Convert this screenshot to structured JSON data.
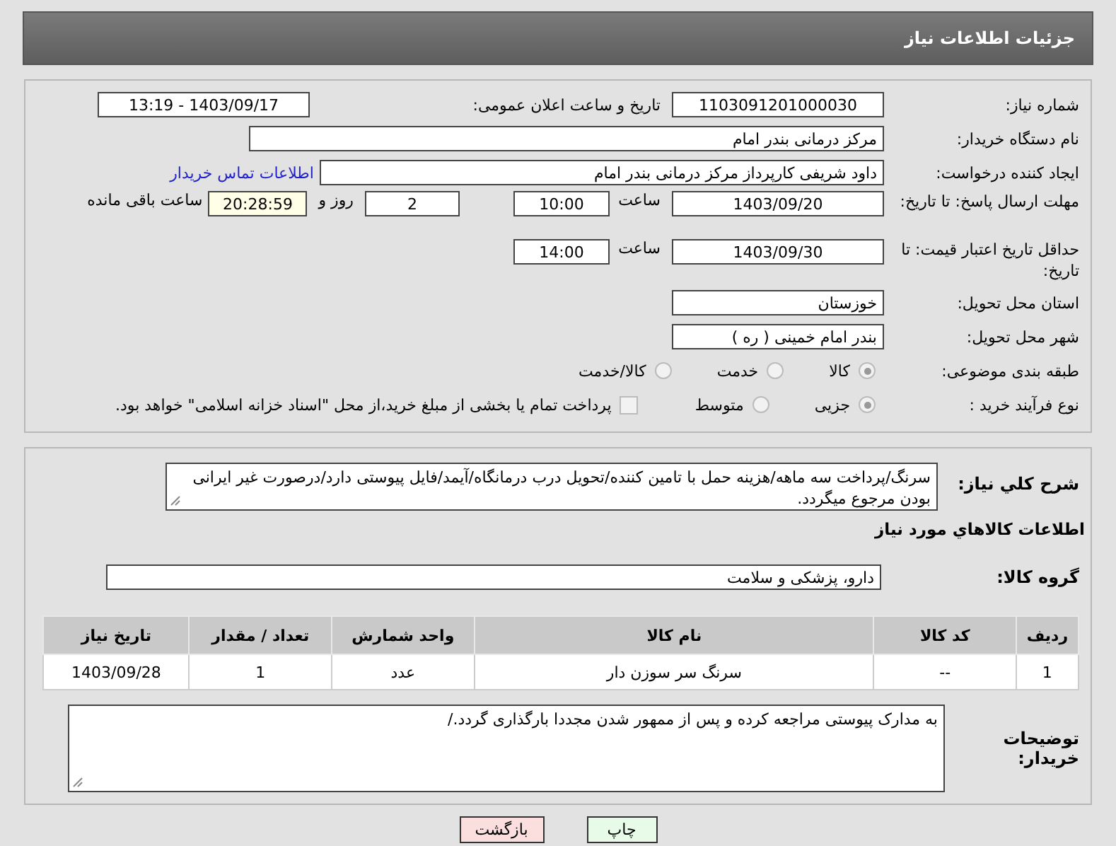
{
  "header": {
    "title": "جزئیات اطلاعات نیاز"
  },
  "details": {
    "need_number": {
      "label": "شماره نیاز:",
      "value": "1103091201000030"
    },
    "announce": {
      "label": "تاریخ و ساعت اعلان عمومی:",
      "value": "1403/09/17 - 13:19"
    },
    "buyer_org": {
      "label": "نام دستگاه خریدار:",
      "value": "مرکز درمانی بندر امام"
    },
    "requester": {
      "label": "ایجاد کننده درخواست:",
      "value": "داود شریفی کارپرداز مرکز درمانی بندر امام",
      "link": "اطلاعات تماس خریدار"
    },
    "response_deadline": {
      "label": "مهلت ارسال پاسخ: تا تاریخ:",
      "date": "1403/09/20",
      "time_label": "ساعت",
      "time": "10:00",
      "days": "2",
      "days_label": "روز و",
      "remaining": "20:28:59",
      "remaining_label": "ساعت باقی مانده"
    },
    "price_validity": {
      "label": "حداقل تاریخ اعتبار قیمت: تا تاریخ:",
      "date": "1403/09/30",
      "time_label": "ساعت",
      "time": "14:00"
    },
    "province": {
      "label": "استان محل تحویل:",
      "value": "خوزستان"
    },
    "city": {
      "label": "شهر محل تحویل:",
      "value": "بندر امام خمینی ( ره )"
    },
    "category": {
      "label": "طبقه بندی موضوعی:",
      "options": [
        {
          "label": "کالا",
          "selected": true
        },
        {
          "label": "خدمت",
          "selected": false
        },
        {
          "label": "کالا/خدمت",
          "selected": false
        }
      ]
    },
    "purchase_type": {
      "label": "نوع فرآیند خرید :",
      "options": [
        {
          "label": "جزیی",
          "selected": true
        },
        {
          "label": "متوسط",
          "selected": false
        }
      ],
      "checkbox": {
        "label": "پرداخت تمام یا بخشی از مبلغ خرید،از محل \"اسناد خزانه اسلامی\" خواهد بود.",
        "checked": false
      }
    }
  },
  "goods": {
    "description": {
      "label": "شرح کلي نیاز:",
      "value": "سرنگ/پرداخت سه ماهه/هزینه حمل با تامین کننده/تحویل درب درمانگاه/آیمد/فایل پیوستی دارد/درصورت غیر ایرانی بودن مرجوع میگردد."
    },
    "heading": "اطلاعات کالاهاي مورد نياز",
    "group": {
      "label": "گروه کالا:",
      "value": "دارو، پزشکی و سلامت"
    },
    "table": {
      "columns": [
        "ردیف",
        "کد کالا",
        "نام کالا",
        "واحد شمارش",
        "تعداد / مقدار",
        "تاریخ نیاز"
      ],
      "rows": [
        [
          "1",
          "--",
          "سرنگ سر سوزن دار",
          "عدد",
          "1",
          "1403/09/28"
        ]
      ]
    },
    "notes": {
      "label": "توضیحات خریدار:",
      "value": "به مدارک پیوستی مراجعه کرده و پس از ممهور شدن مجددا بارگذاری گردد./"
    }
  },
  "buttons": [
    {
      "label": "چاپ",
      "kind": "print"
    },
    {
      "label": "بازگشت",
      "kind": "back"
    }
  ]
}
